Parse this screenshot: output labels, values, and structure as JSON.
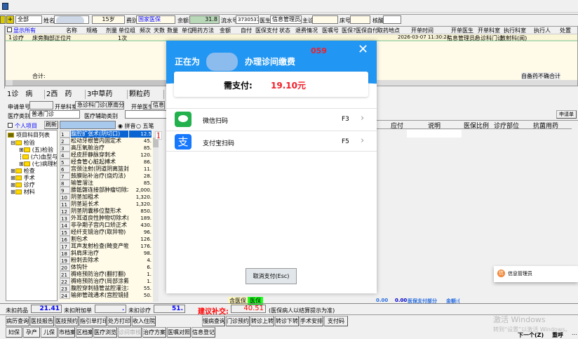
{
  "toolbar": {
    "exit_icon": "exit-door-icon"
  },
  "patient": {
    "filter": "全部",
    "name_label": "姓名",
    "age": "15岁",
    "fee_label": "费别",
    "fee_type": "国家医保",
    "balance_label": "余额",
    "balance": "31.8",
    "serial_label": "流水号",
    "serial": "3730537",
    "doctor_label": "医生",
    "doctor": "信息管理员/0",
    "main_label": "主诊",
    "bed_label": "床号",
    "nucleic_label": "核酸"
  },
  "order_table": {
    "show_all": "显示所有",
    "headers": [
      "名称",
      "规格",
      "剂量",
      "单位组",
      "频次",
      "天数",
      "数量",
      "单位",
      "用药方法",
      "金额",
      "自付",
      "医保支付",
      "状态",
      "退费情况",
      "医嘱号",
      "医保?",
      "医保自付",
      "取药地点",
      "开单时间",
      "开单医生",
      "开单科室",
      "执行科室",
      "执行人",
      "处置"
    ],
    "rows": [
      {
        "no": "1",
        "type": "诊疗",
        "name": "床旁胸部正位片",
        "qty": "1次",
        "time": "2026-03-07 11:30:21",
        "doctor": "信息管理员/",
        "dept": "急诊科门诊",
        "exec": "放射科(阅)"
      }
    ],
    "total_label": "合计:",
    "note": "自备药不确合计"
  },
  "tabs": [
    {
      "label": "1诊　病"
    },
    {
      "label": "2西　药"
    },
    {
      "label": "3中草药"
    },
    {
      "label": "颗粒药"
    }
  ],
  "form": {
    "apply_no_label": "申请单号",
    "dept_label": "开单科室",
    "dept": "急诊科门诊(原南分院)",
    "doctor_label": "开单医生",
    "doctor": "信息",
    "category_label": "医疗类别",
    "category": "普通门诊",
    "aux_label": "医疗辅助类别",
    "apply_button": "申请单"
  },
  "search": {
    "personal": "个人项目",
    "refresh": "刷新",
    "pinyin": "拼音",
    "wubi": "五笔"
  },
  "tree": {
    "root": "项目科目列表",
    "nodes": [
      {
        "label": "检验",
        "children": [
          "(五)检验",
          "(六)血型与",
          "(七)病理检"
        ]
      },
      {
        "label": "检查"
      },
      {
        "label": "手术"
      },
      {
        "label": "诊疗"
      },
      {
        "label": "材料"
      }
    ]
  },
  "items": [
    {
      "n": "1",
      "name": "腹腔扩张术(阴切口)",
      "price": "12.5"
    },
    {
      "n": "2",
      "name": "松动牙根管内固定术",
      "price": "45."
    },
    {
      "n": "3",
      "name": "高压氧舱治疗",
      "price": "85."
    },
    {
      "n": "4",
      "name": "经皮肝静脉穿刺术",
      "price": "120."
    },
    {
      "n": "5",
      "name": "经食管心脏起搏术",
      "price": "86."
    },
    {
      "n": "6",
      "name": "宫颈注射(阴道阴离篮封闭",
      "price": "11."
    },
    {
      "n": "7",
      "name": "鼓膜贴补治疗(烧灼法)",
      "price": "28."
    },
    {
      "n": "8",
      "name": "输管溜注",
      "price": "85."
    },
    {
      "n": "9",
      "name": "腰骶髂连接部肿瘤切除术",
      "price": "2,000."
    },
    {
      "n": "10",
      "name": "阴茎加粗术",
      "price": "1,320."
    },
    {
      "n": "11",
      "name": "阴茎延长术",
      "price": "1,320."
    },
    {
      "n": "12",
      "name": "阴茎阴囊移位整形术",
      "price": "850."
    },
    {
      "n": "13",
      "name": "外耳道良性肿物切除术(",
      "price": "189."
    },
    {
      "n": "14",
      "name": "非孕期子宫内口矫正术",
      "price": "430."
    },
    {
      "n": "15",
      "name": "经纤支镜治疗(取异物)",
      "price": "96."
    },
    {
      "n": "16",
      "name": "割包术",
      "price": "126."
    },
    {
      "n": "17",
      "name": "耳声发射检查(畸变产物)",
      "price": "176."
    },
    {
      "n": "18",
      "name": "斜肩床治疗",
      "price": "98."
    },
    {
      "n": "19",
      "name": "粉刺去除术",
      "price": "4."
    },
    {
      "n": "20",
      "name": "体钩针",
      "price": "6."
    },
    {
      "n": "21",
      "name": "褥疮预防治疗(翻打翻)",
      "price": "1."
    },
    {
      "n": "22",
      "name": "褥疮预防治疗(局部涂氟)",
      "price": "1."
    },
    {
      "n": "23",
      "name": "腹腔穿刺插管盆腔灌注术",
      "price": "55."
    },
    {
      "n": "24",
      "name": "输卵管疏通术(宫腔镜插管",
      "price": "50."
    }
  ],
  "marker": "1",
  "right_grid": {
    "headers": [
      "额",
      "应付",
      "说明",
      "医保比例",
      "诊疗部位",
      "抗菌用药"
    ]
  },
  "modal": {
    "title_prefix": "正在为",
    "title_suffix": "办理诊间缴费",
    "countdown": "059",
    "amount_label": "需支付:",
    "amount": "19.10元",
    "methods": [
      {
        "label": "微信扫码",
        "key": "F3",
        "icon": "wechat-icon"
      },
      {
        "label": "支付宝扫码",
        "key": "F5",
        "icon": "alipay-icon"
      }
    ],
    "cancel": "取消支付(Esc)",
    "colors": {
      "header": "#2196f3",
      "amount": "#f0202a"
    }
  },
  "ins": {
    "with": "含医保",
    "ins": "医保",
    "v1": "0.00",
    "v2": "0.00",
    "part": "医保支付部分",
    "amount": "金额:("
  },
  "summary": {
    "drug_label": "未扣药品",
    "drug": "21.41",
    "extra_label": "未扣附加单",
    "extra": ".",
    "treat_label": "未扣诊疗",
    "treat": "51.",
    "suggest_label": "建议补交:",
    "suggest": "40.51",
    "note": "(医保病人以结算提示为准)"
  },
  "buttons1": [
    "病历查询",
    "医技报告",
    "医技预约",
    "指引单打印",
    "处方打印",
    "收入住院"
  ],
  "buttons1r": [
    "慢病查询",
    "门诊预约",
    "转诊上转",
    "转诊下转",
    "手术安排",
    "支付码"
  ],
  "buttons2": [
    "妇保",
    "孕产",
    "儿保",
    "市档案",
    "区档案",
    "医疗浏览",
    "诊间审核",
    "治疗方案",
    "医嘱对照",
    "信息登记"
  ],
  "notify": {
    "user": "信息管理员",
    "avatar": "信"
  },
  "watermark": {
    "line1": "激活 Windows",
    "line2": "转到“设置”以激活 Windows。"
  },
  "bottom": {
    "next": "下一个(Z)",
    "recall": "重呼",
    "more": "..."
  }
}
